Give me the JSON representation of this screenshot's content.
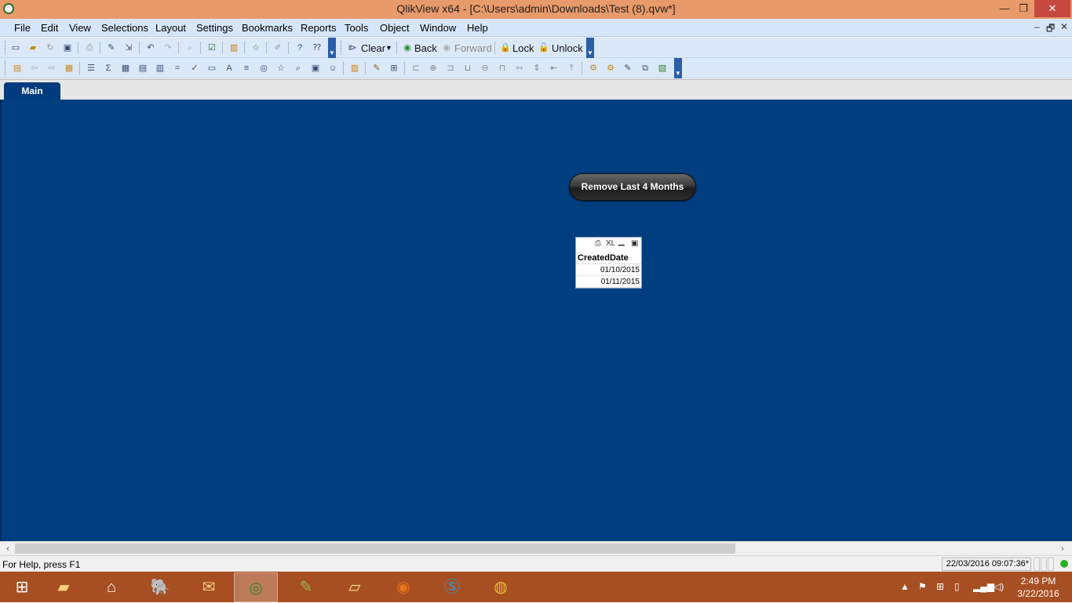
{
  "window": {
    "title": "QlikView x64 - [C:\\Users\\admin\\Downloads\\Test (8).qvw*]",
    "controls": {
      "minimize": "—",
      "restore": "❐",
      "close": "✕"
    }
  },
  "menu": {
    "items": [
      "File",
      "Edit",
      "View",
      "Selections",
      "Layout",
      "Settings",
      "Bookmarks",
      "Reports",
      "Tools",
      "Object",
      "Window",
      "Help"
    ],
    "mdi_controls": {
      "minimize": "–",
      "restore": "🗗",
      "close": "✕"
    }
  },
  "toolbar": {
    "clear_label": "Clear",
    "back_label": "Back",
    "forward_label": "Forward",
    "lock_label": "Lock",
    "unlock_label": "Unlock"
  },
  "sheet": {
    "tab_label": "Main",
    "background": "#003e80"
  },
  "button": {
    "label": "Remove Last 4 Months"
  },
  "listbox": {
    "caption_icons": "XL",
    "header": "CreatedDate",
    "values": [
      "01/10/2015",
      "01/11/2015"
    ]
  },
  "status": {
    "help_text": "For Help, press F1",
    "timestamp": "22/03/2016 09:07:36*"
  },
  "taskbar": {
    "time": "2:49 PM",
    "date": "3/22/2016"
  }
}
